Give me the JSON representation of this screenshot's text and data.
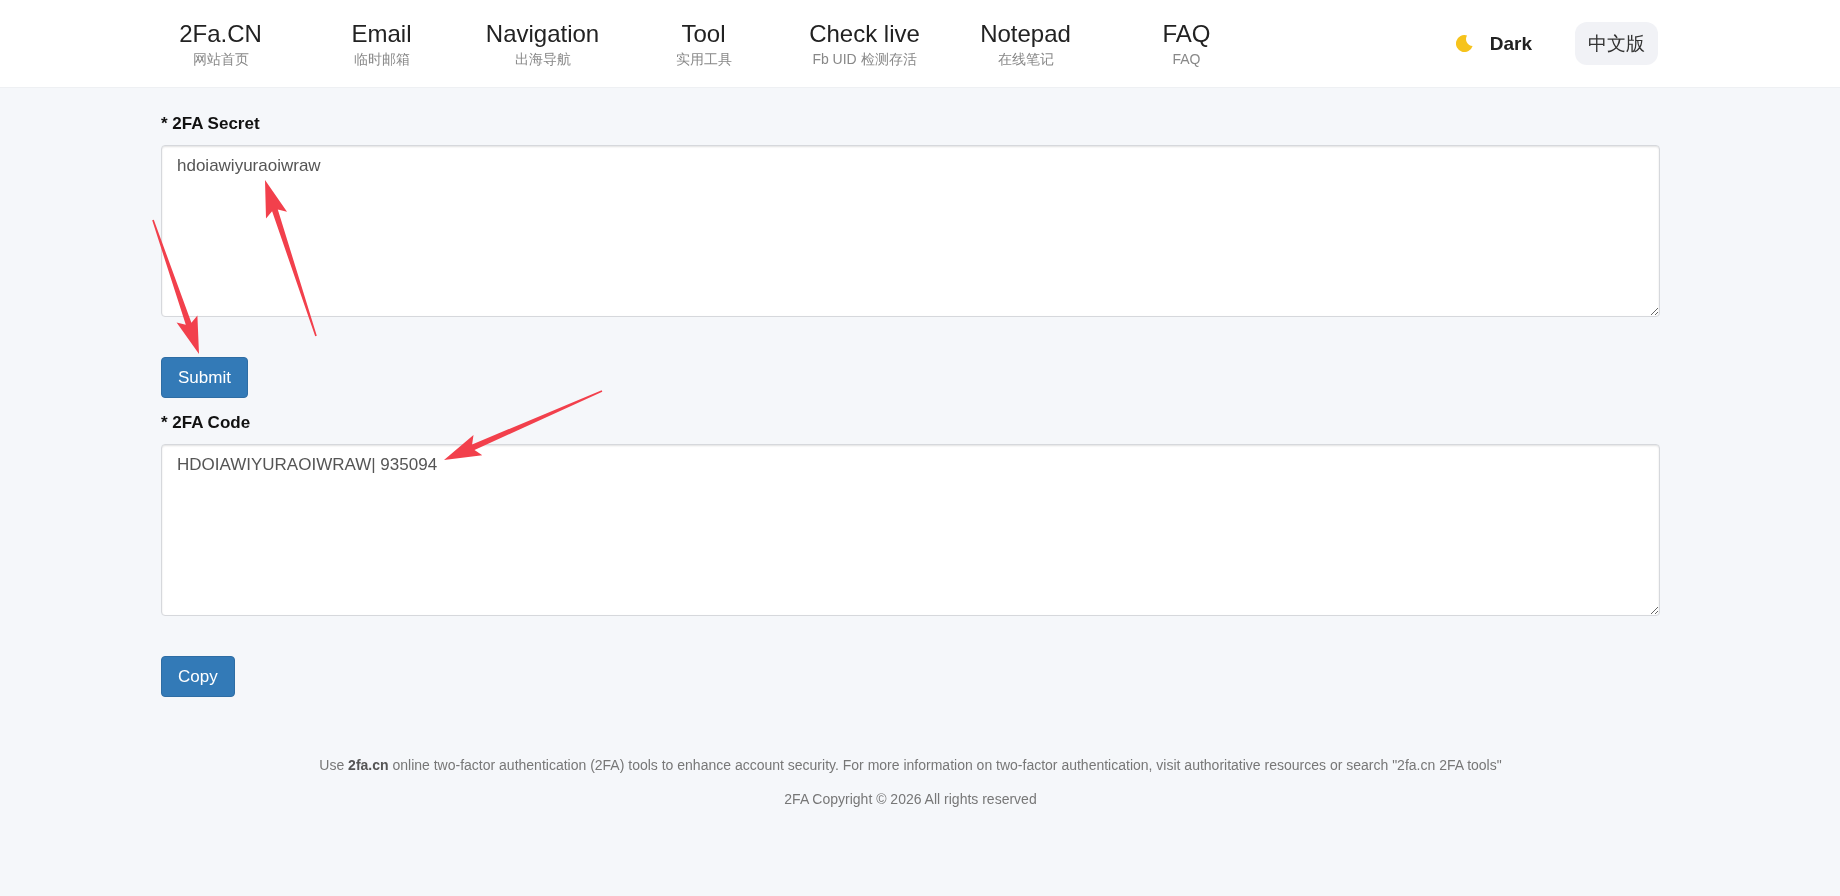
{
  "nav": {
    "items": [
      {
        "title": "2Fa.CN",
        "subtitle": "网站首页"
      },
      {
        "title": "Email",
        "subtitle": "临时邮箱"
      },
      {
        "title": "Navigation",
        "subtitle": "出海导航"
      },
      {
        "title": "Tool",
        "subtitle": "实用工具"
      },
      {
        "title": "Check live",
        "subtitle": "Fb UID 检测存活"
      },
      {
        "title": "Notepad",
        "subtitle": "在线笔记"
      },
      {
        "title": "FAQ",
        "subtitle": "FAQ"
      }
    ]
  },
  "theme_toggle": {
    "label": "Dark"
  },
  "language_button": {
    "label": "中文版"
  },
  "form": {
    "fields": [
      {
        "label": "* 2FA Secret",
        "value": "hdoiawiyuraoiwraw",
        "button": "Submit"
      },
      {
        "label": "* 2FA Code",
        "value": "HDOIAWIYURAOIWRAW| 935094",
        "button": "Copy"
      }
    ]
  },
  "footer": {
    "note": "Use **2fa.cn** online two-factor authentication (2FA) tools to enhance account security. For more information on two-factor authentication, visit authoritative resources or search \"2fa.cn 2FA tools\"",
    "copyright": "2FA Copyright © 2026 All rights reserved"
  },
  "annotations": [
    {
      "kind": "arrow"
    },
    {
      "kind": "arrow"
    },
    {
      "kind": "arrow"
    }
  ]
}
